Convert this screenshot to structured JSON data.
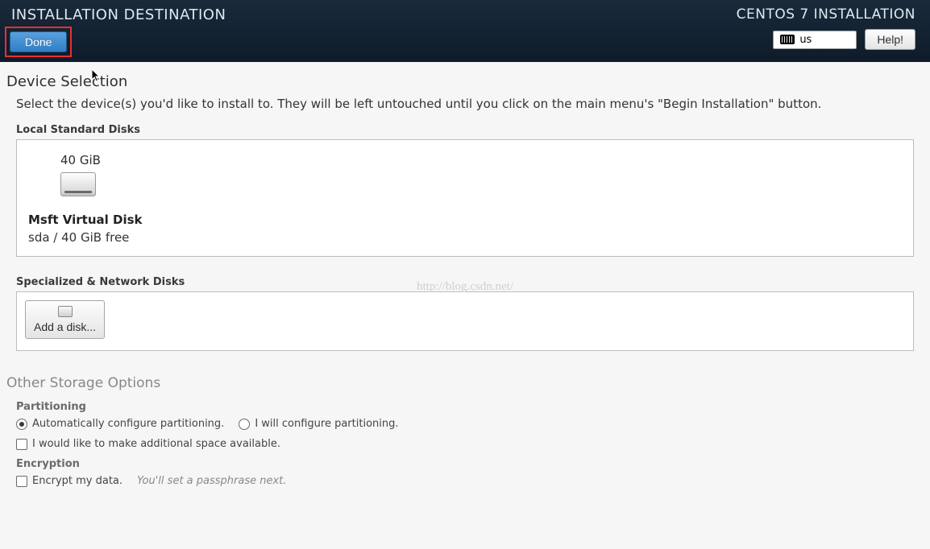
{
  "header": {
    "title": "INSTALLATION DESTINATION",
    "right_title": "CENTOS 7 INSTALLATION",
    "done_label": "Done",
    "help_label": "Help!",
    "locale": "us"
  },
  "device_selection": {
    "heading": "Device Selection",
    "description": "Select the device(s) you'd like to install to.  They will be left untouched until you click on the main menu's \"Begin Installation\" button."
  },
  "local_disks": {
    "label": "Local Standard Disks",
    "items": [
      {
        "size": "40 GiB",
        "name": "Msft Virtual Disk",
        "detail": "sda / 40 GiB free"
      }
    ]
  },
  "network_disks": {
    "label": "Specialized & Network Disks",
    "add_label": "Add a disk..."
  },
  "other_storage": {
    "heading": "Other Storage Options",
    "partitioning_label": "Partitioning",
    "auto_label": "Automatically configure partitioning.",
    "manual_label": "I will configure partitioning.",
    "additional_space_label": "I would like to make additional space available.",
    "encryption_label": "Encryption",
    "encrypt_label": "Encrypt my data.",
    "encrypt_hint": "You'll set a passphrase next."
  },
  "watermark": "http://blog.csdn.net/"
}
